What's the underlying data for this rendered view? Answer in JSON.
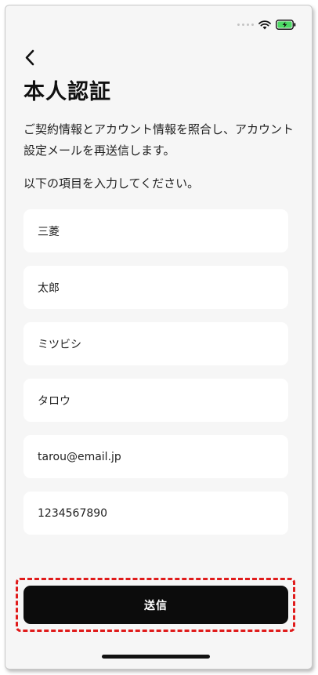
{
  "header": {
    "title": "本人認証"
  },
  "description": "ご契約情報とアカウント情報を照合し、アカウント設定メールを再送信します。",
  "instruction": "以下の項目を入力してください。",
  "form": {
    "fields": [
      {
        "id": "last-name",
        "value": "三菱"
      },
      {
        "id": "first-name",
        "value": "太郎"
      },
      {
        "id": "last-name-kana",
        "value": "ミツビシ"
      },
      {
        "id": "first-name-kana",
        "value": "タロウ"
      },
      {
        "id": "email",
        "value": "tarou@email.jp"
      },
      {
        "id": "phone",
        "value": "1234567890"
      }
    ],
    "submit_label": "送信"
  },
  "icons": {
    "back": "chevron-left-icon",
    "signal": "cellular-signal-icon",
    "wifi": "wifi-icon",
    "battery": "battery-charging-icon"
  },
  "colors": {
    "background": "#f6f6f6",
    "field_background": "#ffffff",
    "button_background": "#0c0c0c",
    "highlight": "#e01b1b",
    "battery_fill": "#4cd964"
  }
}
